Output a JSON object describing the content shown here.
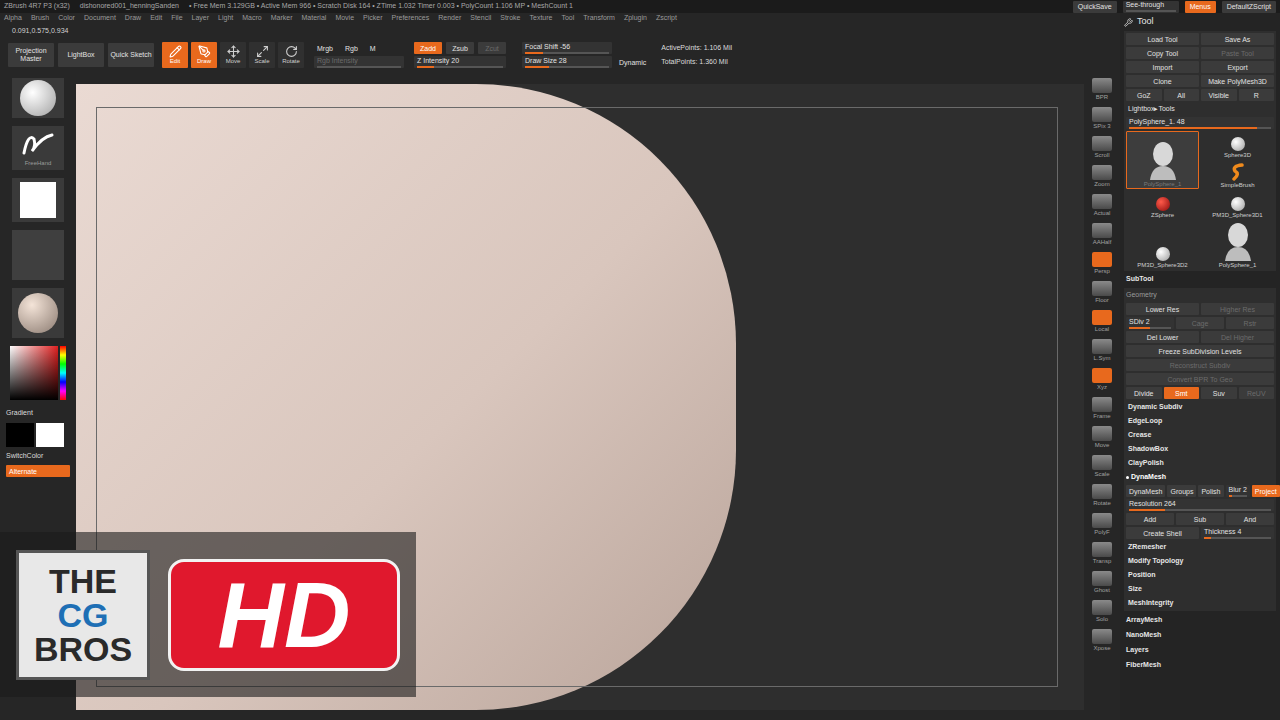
{
  "title_bar": {
    "segments": [
      "ZBrush 4R7 P3 (x32)",
      "dishonored001_henningSanden",
      "• Free Mem 3.129GB • Active Mem 966 • Scratch Disk 164 • ZTime 1.032 Timer 0.003 • PolyCount 1.106 MP • MeshCount 1"
    ],
    "buttons": [
      {
        "kind": "button",
        "label": "QuickSave",
        "selected": false
      },
      {
        "kind": "slider",
        "label": "See-through",
        "selected": false,
        "level": 0
      },
      {
        "kind": "button",
        "label": "Menus",
        "selected": true
      },
      {
        "kind": "button",
        "label": "DefaultZScript",
        "selected": false
      }
    ]
  },
  "menu": [
    "Alpha",
    "Brush",
    "Color",
    "Document",
    "Draw",
    "Edit",
    "File",
    "Layer",
    "Light",
    "Macro",
    "Marker",
    "Material",
    "Movie",
    "Picker",
    "Preferences",
    "Render",
    "Stencil",
    "Stroke",
    "Texture",
    "Tool",
    "Transform",
    "Zplugin",
    "Zscript"
  ],
  "coords": "0.091,0.575,0.934",
  "toolbar": {
    "left": [
      {
        "label": "Projection Master"
      },
      {
        "label": "LightBox"
      },
      {
        "label": "Quick Sketch"
      }
    ],
    "modes": [
      {
        "label": "Edit",
        "selected": true
      },
      {
        "label": "Draw",
        "selected": true
      },
      {
        "label": "Move",
        "selected": false
      },
      {
        "label": "Scale",
        "selected": false
      },
      {
        "label": "Rotate",
        "selected": false
      }
    ],
    "color_modes": [
      {
        "label": "Mrgb",
        "selected": false,
        "disabled": false
      },
      {
        "label": "Rgb",
        "selected": false,
        "disabled": false
      },
      {
        "label": "M",
        "selected": false,
        "disabled": false
      }
    ],
    "rgb_intensity": {
      "label": "Rgb Intensity",
      "level": 0,
      "disabled": true
    },
    "z_modes": [
      {
        "label": "Zadd",
        "selected": true,
        "disabled": false
      },
      {
        "label": "Zsub",
        "selected": false,
        "disabled": false
      },
      {
        "label": "Zcut",
        "selected": false,
        "disabled": true
      }
    ],
    "z_intensity": {
      "label": "Z Intensity 20",
      "level": 0.2,
      "disabled": false
    },
    "focal_shift": {
      "label": "Focal Shift -56",
      "level": 0.22,
      "disabled": false
    },
    "draw_size": {
      "label": "Draw Size 28",
      "level": 0.28,
      "disabled": false
    },
    "dynamic": "Dynamic",
    "stats": [
      "ActivePoints: 1.106 Mil",
      "TotalPoints: 1.360 Mil"
    ]
  },
  "left_shelf": {
    "stroke": "FreeHand",
    "gradient": "Gradient",
    "switch_color": "SwitchColor",
    "alternate": {
      "label": "Alternate",
      "selected": true
    }
  },
  "right_shelf": [
    {
      "label": "BPR",
      "selected": false
    },
    {
      "label": "SPix 3",
      "selected": false
    },
    {
      "label": "Scroll",
      "selected": false
    },
    {
      "label": "Zoom",
      "selected": false
    },
    {
      "label": "Actual",
      "selected": false
    },
    {
      "label": "AAHalf",
      "selected": false
    },
    {
      "label": "Persp",
      "selected": true
    },
    {
      "label": "Floor",
      "selected": false
    },
    {
      "label": "Local",
      "selected": true
    },
    {
      "label": "L.Sym",
      "selected": false
    },
    {
      "label": "Xyz",
      "selected": true
    },
    {
      "label": "Frame",
      "selected": false
    },
    {
      "label": "Move",
      "selected": false
    },
    {
      "label": "Scale",
      "selected": false
    },
    {
      "label": "Rotate",
      "selected": false
    },
    {
      "label": "PolyF",
      "selected": false
    },
    {
      "label": "Transp",
      "selected": false
    },
    {
      "label": "Ghost",
      "selected": false
    },
    {
      "label": "Solo",
      "selected": false
    },
    {
      "label": "Xpose",
      "selected": false
    }
  ],
  "tool_panel": {
    "title": "Tool",
    "button_rows": [
      [
        {
          "label": "Load Tool",
          "selected": false,
          "disabled": false
        },
        {
          "label": "Save As",
          "selected": false,
          "disabled": false
        }
      ],
      [
        {
          "label": "Copy Tool",
          "selected": false,
          "disabled": false
        },
        {
          "label": "Paste Tool",
          "selected": false,
          "disabled": true
        }
      ],
      [
        {
          "label": "Import",
          "selected": false,
          "disabled": false
        },
        {
          "label": "Export",
          "selected": false,
          "disabled": false
        }
      ],
      [
        {
          "label": "Clone",
          "selected": false,
          "disabled": false
        },
        {
          "label": "Make PolyMesh3D",
          "selected": false,
          "disabled": false
        }
      ],
      [
        {
          "label": "GoZ",
          "selected": false,
          "disabled": false
        },
        {
          "label": "All",
          "selected": false,
          "disabled": false
        },
        {
          "label": "Visible",
          "selected": false,
          "disabled": false
        },
        {
          "label": "R",
          "selected": false,
          "disabled": false
        }
      ]
    ],
    "lightbox_tools": "Lightbox▸Tools",
    "current": {
      "label": "PolySphere_1. 48",
      "level": 0.9,
      "disabled": false
    },
    "thumbs": [
      {
        "label": "PolySphere_1",
        "kind": "head",
        "selected": true
      },
      {
        "label": "Sphere3D",
        "kind": "sphere",
        "selected": false
      },
      {
        "label": "SimpleBrush",
        "kind": "brush",
        "selected": false
      },
      {
        "label": "ZSphere",
        "kind": "zsphere",
        "selected": false
      },
      {
        "label": "PM3D_Sphere3D1",
        "kind": "sphere",
        "selected": false
      },
      {
        "label": "PM3D_Sphere3D2",
        "kind": "sphere",
        "selected": false
      },
      {
        "label": "PolySphere_1",
        "kind": "head",
        "selected": false
      }
    ],
    "subtool": "SubTool",
    "geometry": {
      "title": "Geometry",
      "rows": [
        {
          "kind": "buttons",
          "items": [
            {
              "kind": "button",
              "label": "Lower Res",
              "selected": false,
              "disabled": false
            },
            {
              "kind": "button",
              "label": "Higher Res",
              "selected": false,
              "disabled": true
            }
          ]
        },
        {
          "kind": "buttons",
          "items": [
            {
              "kind": "slider",
              "label": "SDiv 2",
              "level": 0.5,
              "disabled": false
            },
            {
              "kind": "button",
              "label": "Cage",
              "selected": false,
              "disabled": true
            },
            {
              "kind": "button",
              "label": "Rstr",
              "selected": false,
              "disabled": true
            }
          ]
        },
        {
          "kind": "buttons",
          "items": [
            {
              "kind": "button",
              "label": "Del Lower",
              "selected": false,
              "disabled": false
            },
            {
              "kind": "button",
              "label": "Del Higher",
              "selected": false,
              "disabled": true
            }
          ]
        },
        {
          "kind": "buttons",
          "items": [
            {
              "kind": "button",
              "label": "Freeze SubDivision Levels",
              "selected": false,
              "disabled": false
            }
          ]
        },
        {
          "kind": "buttons",
          "items": [
            {
              "kind": "button",
              "label": "Reconstruct Subdiv",
              "selected": false,
              "disabled": true
            }
          ]
        },
        {
          "kind": "buttons",
          "items": [
            {
              "kind": "button",
              "label": "Convert BPR To Geo",
              "selected": false,
              "disabled": true
            }
          ]
        },
        {
          "kind": "buttons",
          "items": [
            {
              "kind": "button",
              "label": "Divide",
              "selected": false,
              "disabled": false
            },
            {
              "kind": "button",
              "label": "Smt",
              "selected": true,
              "disabled": false
            },
            {
              "kind": "button",
              "label": "Suv",
              "selected": false,
              "disabled": false
            },
            {
              "kind": "button",
              "label": "ReUV",
              "selected": false,
              "disabled": true
            }
          ]
        },
        {
          "kind": "subpalette",
          "label": "Dynamic Subdiv"
        },
        {
          "kind": "subpalette",
          "label": "EdgeLoop"
        },
        {
          "kind": "subpalette",
          "label": "Crease"
        },
        {
          "kind": "subpalette",
          "label": "ShadowBox"
        },
        {
          "kind": "subpalette",
          "label": "ClayPolish"
        },
        {
          "kind": "section",
          "label": "DynaMesh",
          "expanded": true
        },
        {
          "kind": "buttons",
          "items": [
            {
              "kind": "button",
              "label": "DynaMesh",
              "selected": false,
              "disabled": false
            },
            {
              "kind": "button",
              "label": "Groups",
              "selected": false,
              "disabled": false
            },
            {
              "kind": "button",
              "label": "Polish",
              "selected": false,
              "disabled": false
            },
            {
              "kind": "slider",
              "label": "Blur 2",
              "level": 0.2,
              "disabled": false
            },
            {
              "kind": "button",
              "label": "Project",
              "selected": true,
              "disabled": false
            }
          ]
        },
        {
          "kind": "buttons",
          "items": [
            {
              "kind": "slider",
              "label": "Resolution 264",
              "level": 0.25,
              "disabled": false
            }
          ]
        },
        {
          "kind": "buttons",
          "items": [
            {
              "kind": "button",
              "label": "Add",
              "selected": false,
              "disabled": false
            },
            {
              "kind": "button",
              "label": "Sub",
              "selected": false,
              "disabled": false
            },
            {
              "kind": "button",
              "label": "And",
              "selected": false,
              "disabled": false
            }
          ]
        },
        {
          "kind": "buttons",
          "items": [
            {
              "kind": "button",
              "label": "Create Shell",
              "selected": false,
              "disabled": false
            },
            {
              "kind": "slider",
              "label": "Thickness 4",
              "level": 0.1,
              "disabled": false
            }
          ]
        },
        {
          "kind": "subpalette",
          "label": "ZRemesher"
        },
        {
          "kind": "subpalette",
          "label": "Modify Topology"
        },
        {
          "kind": "subpalette",
          "label": "Position"
        },
        {
          "kind": "subpalette",
          "label": "Size"
        },
        {
          "kind": "subpalette",
          "label": "MeshIntegrity"
        }
      ]
    },
    "palettes": [
      "ArrayMesh",
      "NanoMesh",
      "Layers",
      "FiberMesh"
    ]
  },
  "logo": {
    "box_lines": [
      "THE",
      "CG",
      "BROS"
    ],
    "badge": "HD"
  }
}
